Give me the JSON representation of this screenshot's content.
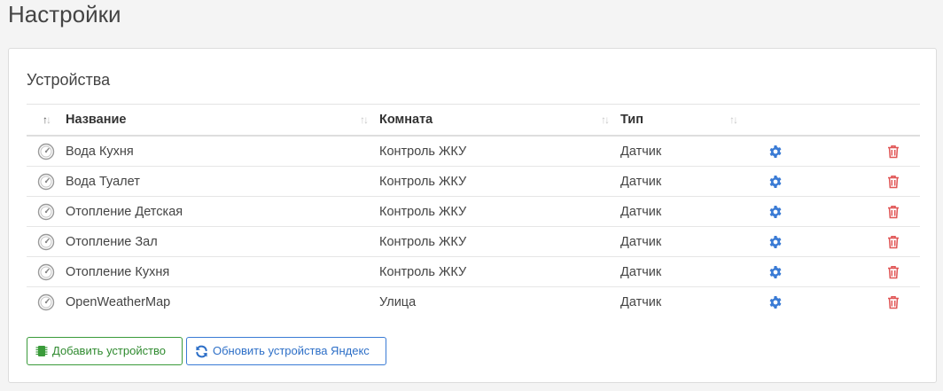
{
  "page": {
    "title": "Настройки"
  },
  "devices": {
    "title": "Устройства",
    "columns": [
      {
        "label": "Название"
      },
      {
        "label": "Комната"
      },
      {
        "label": "Тип"
      }
    ],
    "rows": [
      {
        "name": "Вода Кухня",
        "room": "Контроль ЖКУ",
        "type": "Датчик"
      },
      {
        "name": "Вода Туалет",
        "room": "Контроль ЖКУ",
        "type": "Датчик"
      },
      {
        "name": "Отопление Детская",
        "room": "Контроль ЖКУ",
        "type": "Датчик"
      },
      {
        "name": "Отопление Зал",
        "room": "Контроль ЖКУ",
        "type": "Датчик"
      },
      {
        "name": "Отопление Кухня",
        "room": "Контроль ЖКУ",
        "type": "Датчик"
      },
      {
        "name": "OpenWeatherMap",
        "room": "Улица",
        "type": "Датчик"
      }
    ],
    "row_icon": "gauge-icon",
    "actions": {
      "settings_icon": "gear-icon",
      "delete_icon": "trash-icon"
    }
  },
  "buttons": {
    "add_label": "Добавить устройство",
    "add_icon": "chip-icon",
    "refresh_label": "Обновить устройства Яндекс",
    "refresh_icon": "refresh-icon"
  },
  "colors": {
    "gear": "#3a7bd5",
    "trash": "#e05555",
    "add": "#2f8a2f",
    "refresh": "#2d6fc7"
  }
}
